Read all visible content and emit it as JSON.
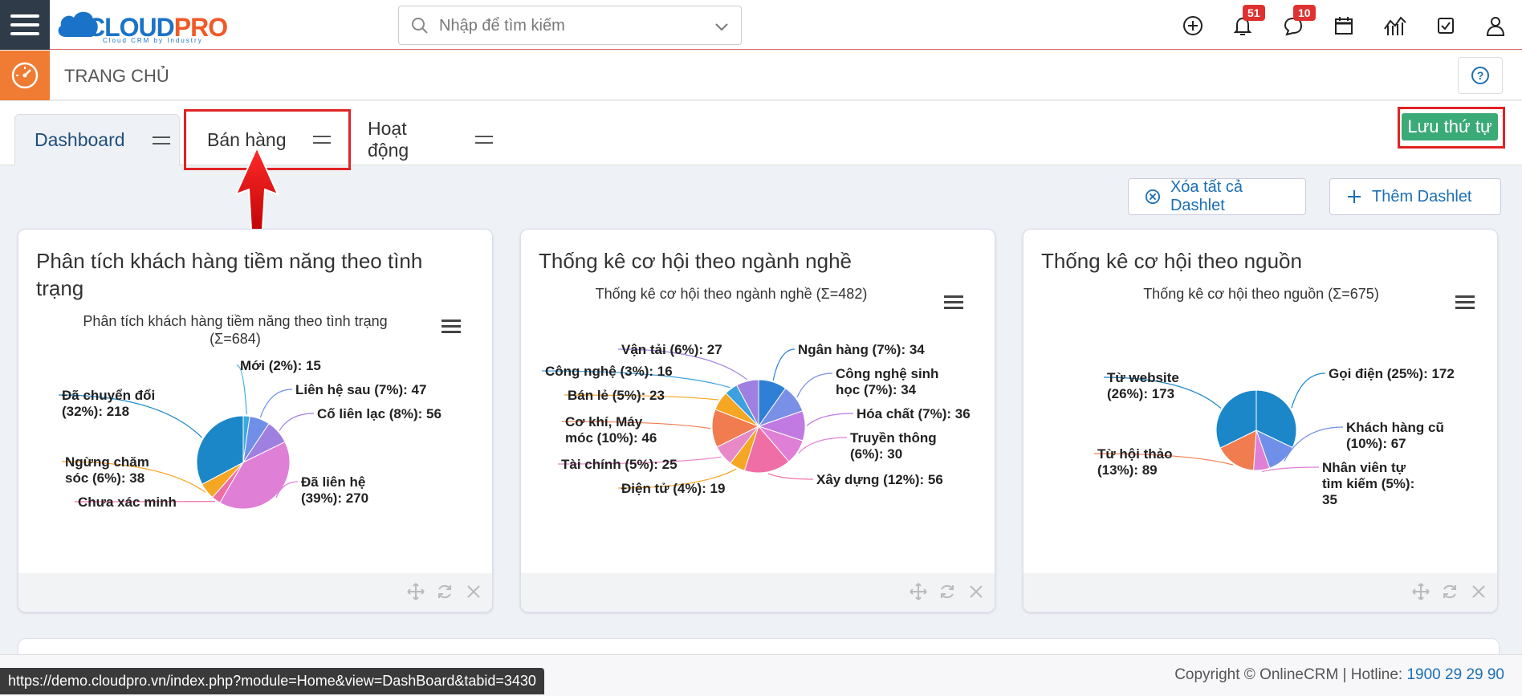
{
  "topbar": {
    "logo_text_1": "CLOUD",
    "logo_text_2": "PRO",
    "logo_tagline": "Cloud CRM by Industry",
    "search_placeholder": "Nhập để tìm kiếm",
    "notifications_count": "51",
    "messages_count": "10",
    "icons": [
      "plus-circle-icon",
      "bell-icon",
      "chat-icon",
      "calendar-icon",
      "chart-icon",
      "checkbox-icon",
      "user-icon"
    ]
  },
  "subbar": {
    "title": "TRANG CHỦ",
    "help_icon": "?"
  },
  "tabs": [
    {
      "label": "Dashboard"
    },
    {
      "label": "Bán hàng"
    },
    {
      "label": "Hoạt động"
    }
  ],
  "save_order_label": "Lưu thứ tự",
  "actions": {
    "clear_all": "Xóa tất cả Dashlet",
    "add": "Thêm Dashlet"
  },
  "dashlets": [
    {
      "title": "Phân tích khách hàng tiềm năng theo tình trạng",
      "chart_title_1": "Phân tích khách hàng tiềm năng theo tình trạng",
      "chart_title_2": "(Σ=684)"
    },
    {
      "title": "Thống kê cơ hội theo ngành nghề",
      "chart_title": "Thống kê cơ hội theo ngành nghề (Σ=482)"
    },
    {
      "title": "Thống kê cơ hội theo nguồn",
      "chart_title": "Thống kê cơ hội theo nguồn (Σ=675)"
    }
  ],
  "chart_data": [
    {
      "type": "pie",
      "title": "Phân tích khách hàng tiềm năng theo tình trạng (Σ=684)",
      "slices": [
        {
          "label": "Mới (2%): 15",
          "value": 15,
          "color": "#3ba9e0"
        },
        {
          "label": "Liên hệ sau (7%): 47",
          "value": 47,
          "color": "#6f8fe8"
        },
        {
          "label": "Cố liên lạc (8%): 56",
          "value": 56,
          "color": "#9f7fe0"
        },
        {
          "label": "Đã liên hệ (39%): 270",
          "value": 270,
          "color": "#e07fd6"
        },
        {
          "label": "Chưa xác minh",
          "value": 21,
          "color": "#f06ea6"
        },
        {
          "label": "Ngừng chăm sóc (6%): 38",
          "value": 38,
          "color": "#f5a623"
        },
        {
          "label": "Đã chuyển đổi (32%): 218",
          "value": 218,
          "color": "#1b87c9"
        }
      ]
    },
    {
      "type": "pie",
      "title": "Thống kê cơ hội theo ngành nghề (Σ=482)",
      "slices": [
        {
          "label": "Ngân hàng (7%): 34",
          "value": 34,
          "color": "#2e7fd6"
        },
        {
          "label": "Công nghệ sinh học (7%): 34",
          "value": 34,
          "color": "#7a8fe6"
        },
        {
          "label": "Hóa chất (7%): 36",
          "value": 36,
          "color": "#c07ae2"
        },
        {
          "label": "Truyền thông (6%): 30",
          "value": 30,
          "color": "#e07fd6"
        },
        {
          "label": "Xây dựng (12%): 56",
          "value": 56,
          "color": "#f06ea6"
        },
        {
          "label": "Điện tử (4%): 19",
          "value": 19,
          "color": "#f5a623"
        },
        {
          "label": "Tài chính (5%): 25",
          "value": 25,
          "color": "#e889c7"
        },
        {
          "label": "Cơ khí, Máy móc (10%): 46",
          "value": 46,
          "color": "#f07c50"
        },
        {
          "label": "Bán lẻ (5%): 23",
          "value": 23,
          "color": "#f5a623"
        },
        {
          "label": "Công nghệ (3%): 16",
          "value": 16,
          "color": "#3da0e0"
        },
        {
          "label": "Vận tải (6%): 27",
          "value": 27,
          "color": "#9f7fe0"
        }
      ]
    },
    {
      "type": "pie",
      "title": "Thống kê cơ hội theo nguồn (Σ=675)",
      "slices": [
        {
          "label": "Gọi điện (25%): 172",
          "value": 172,
          "color": "#1b87c9"
        },
        {
          "label": "Khách hàng cũ (10%): 67",
          "value": 67,
          "color": "#6f8fe8"
        },
        {
          "label": "Nhân viên tự tìm kiếm (5%): 35",
          "value": 35,
          "color": "#e07fd6"
        },
        {
          "label": "Từ hội thảo (13%): 89",
          "value": 89,
          "color": "#f07c50"
        },
        {
          "label": "Từ website (26%): 173",
          "value": 173,
          "color": "#1b87c9"
        }
      ]
    }
  ],
  "footer": {
    "copyright": "Copyright © OnlineCRM",
    "hotline_label": "Hotline:",
    "hotline": "1900 29 29 90",
    "status_url": "https://demo.cloudpro.vn/index.php?module=Home&view=DashBoard&tabid=3430"
  }
}
